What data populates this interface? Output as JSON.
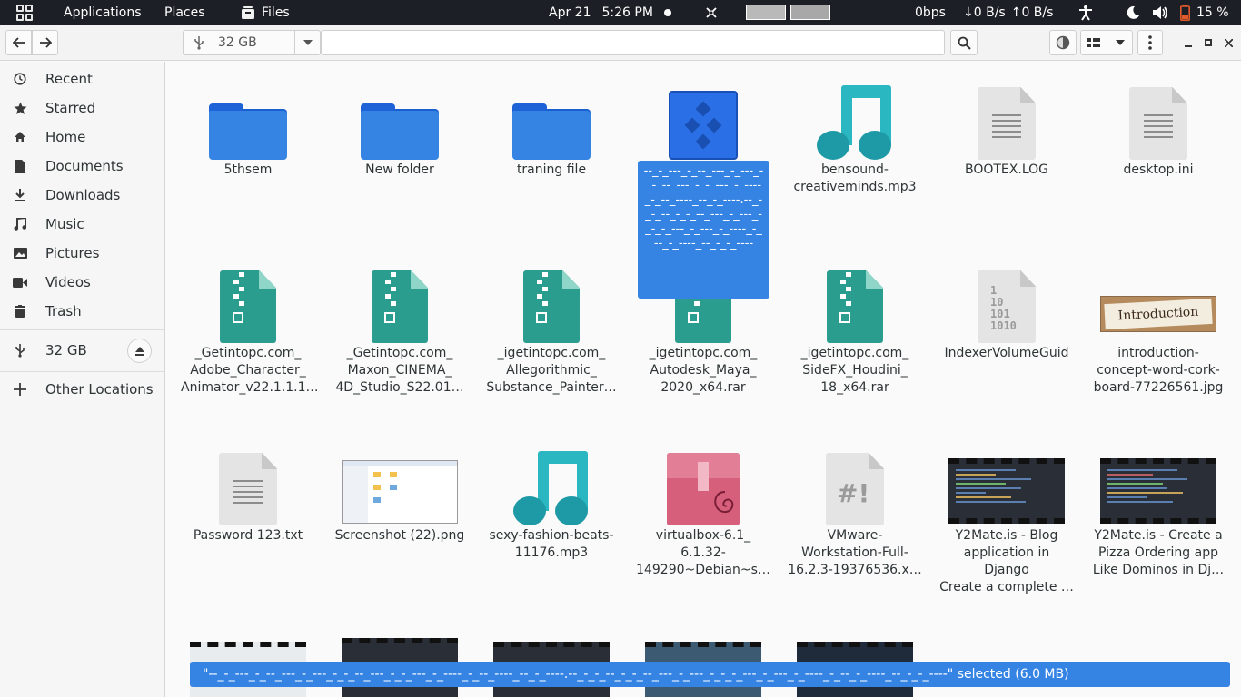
{
  "topbar": {
    "applications": "Applications",
    "places": "Places",
    "files": "Files",
    "date": "Apr 21",
    "time": "5:26 PM",
    "net_rate": "0bps",
    "down": "0 B/s",
    "up": "0 B/s",
    "battery": "15 %"
  },
  "header": {
    "location": "32 GB"
  },
  "sidebar": {
    "items": [
      {
        "label": "Recent",
        "icon": "clock-icon"
      },
      {
        "label": "Starred",
        "icon": "star-icon"
      },
      {
        "label": "Home",
        "icon": "home-icon"
      },
      {
        "label": "Documents",
        "icon": "document-icon"
      },
      {
        "label": "Downloads",
        "icon": "download-icon"
      },
      {
        "label": "Music",
        "icon": "music-icon"
      },
      {
        "label": "Pictures",
        "icon": "picture-icon"
      },
      {
        "label": "Videos",
        "icon": "video-icon"
      },
      {
        "label": "Trash",
        "icon": "trash-icon"
      }
    ],
    "drive": "32 GB",
    "other": "Other Locations"
  },
  "files": [
    {
      "name": "5thsem",
      "kind": "folder"
    },
    {
      "name": "New folder",
      "kind": "folder"
    },
    {
      "name": "traning file",
      "kind": "folder"
    },
    {
      "name": "",
      "kind": "app"
    },
    {
      "name": "bensound-\ncreativeminds.mp3",
      "kind": "music"
    },
    {
      "name": "BOOTEX.LOG",
      "kind": "log"
    },
    {
      "name": "desktop.ini",
      "kind": "text"
    },
    {
      "name": "_Getintopc.com_\nAdobe_Character_\nAnimator_v22.1.1.1…",
      "kind": "zip"
    },
    {
      "name": "_Getintopc.com_\nMaxon_CINEMA_\n4D_Studio_S22.01…",
      "kind": "zip"
    },
    {
      "name": "_igetintopc.com_\nAllegorithmic_\nSubstance_Painter…",
      "kind": "zip"
    },
    {
      "name": "_igetintopc.com_\nAutodesk_Maya_\n2020_x64.rar",
      "kind": "zip"
    },
    {
      "name": "_igetintopc.com_\nSideFX_Houdini_\n18_x64.rar",
      "kind": "zip"
    },
    {
      "name": "IndexerVolumeGuid",
      "kind": "binary"
    },
    {
      "name": "introduction-\nconcept-word-cork-\nboard-77226561.jpg",
      "kind": "image-intro"
    },
    {
      "name": "Password 123.txt",
      "kind": "text"
    },
    {
      "name": "Screenshot (22).png",
      "kind": "screenshot"
    },
    {
      "name": "sexy-fashion-beats-\n11176.mp3",
      "kind": "music"
    },
    {
      "name": "virtualbox-6.1_\n6.1.32-\n149290~Debian~s…",
      "kind": "deb"
    },
    {
      "name": "VMware-\nWorkstation-Full-\n16.2.3-19376536.x…",
      "kind": "script"
    },
    {
      "name": "Y2Mate.is - Blog\napplication in Django\nCreate a complete …",
      "kind": "video"
    },
    {
      "name": "Y2Mate.is - Create a\nPizza Ordering app\nLike Dominos in Dj…",
      "kind": "video"
    }
  ],
  "selected_label": "--_-_---_-_--_---_-_---_-_-_--_---_-_-_---_-_----_-_--_----_--_-_----.--_-_-_--_-_-_--_---_-_---_-_-_-_---_-_---_-_----_-_--_-_----_--_-_-_----",
  "intro_text": "Introduction",
  "status": {
    "text": "\"--_-_---_-_--_---_-_---_-_-_--_---_-_-_---_-_----_-_--_----_--_-_----.--_-_-_--_-_-_--_---_-_---_-_-_-_---_-_---_-_----_-_--_-_----_--_-_-_----\" selected  (6.0 MB)"
  },
  "colors": {
    "accent": "#3584e4",
    "topbar": "#1c1f26",
    "sidebar": "#f6f6f6"
  }
}
